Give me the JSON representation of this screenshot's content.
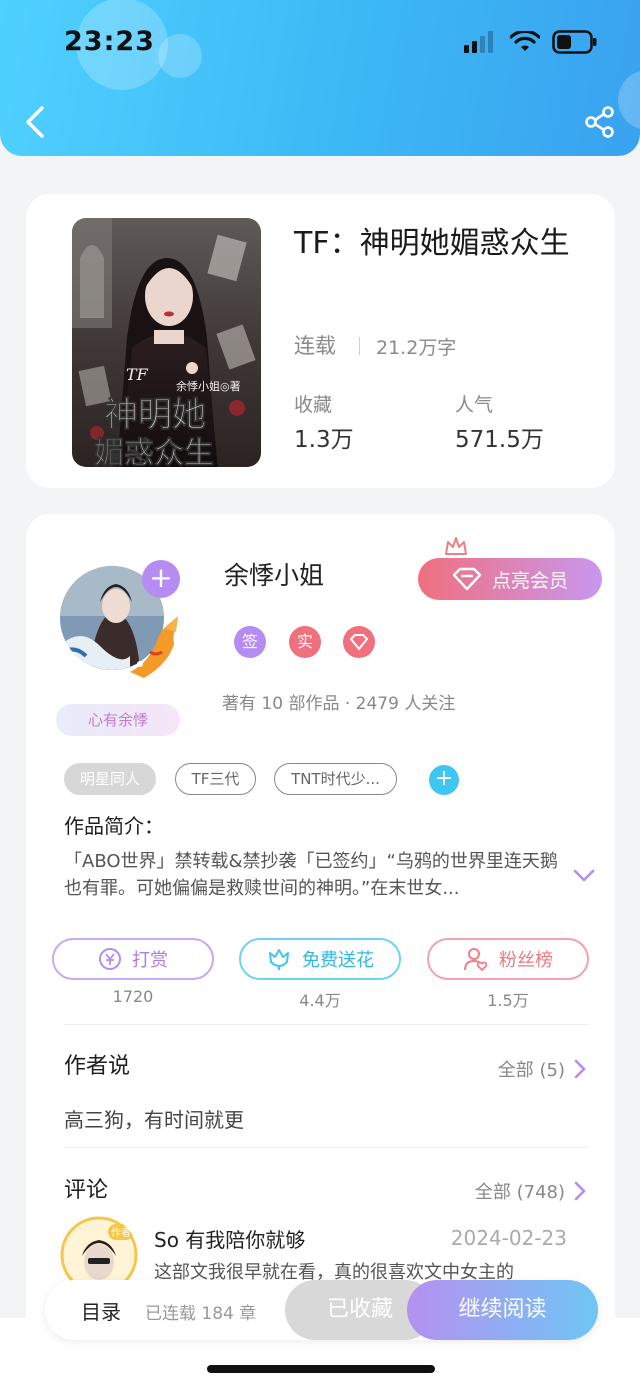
{
  "status_bar": {
    "time": "23:23"
  },
  "header": {
    "back_icon": "chevron-left-icon",
    "share_icon": "share-icon"
  },
  "book": {
    "title": "TF：神明她媚惑众生",
    "status": "连载",
    "word_count": "21.2万字",
    "stats": [
      {
        "label": "收藏",
        "value": "1.3万"
      },
      {
        "label": "人气",
        "value": "571.5万"
      }
    ],
    "cover": {
      "title_line1": "神明她",
      "title_line2": "媚惑众生",
      "prefix": "TF",
      "author_line": "余悸小姐◎著"
    }
  },
  "author": {
    "name": "余悸小姐",
    "vip_button": "点亮会员",
    "badges": [
      "签",
      "实"
    ],
    "meta": "著有 10 部作品 · 2479 人关注",
    "fans_tag": "心有余悸",
    "tags": [
      "明星同人",
      "TF三代",
      "TNT时代少..."
    ],
    "intro_label": "作品简介：",
    "intro": "「ABO世界」禁转载&禁抄袭「已签约」“乌鸦的世界里连天鹅也有罪。可她偏偏是救赎世间的神明。”在末世女..."
  },
  "actions": [
    {
      "label": "打赏",
      "count": "1720",
      "color": "#b48cf2"
    },
    {
      "label": "免费送花",
      "count": "4.4万",
      "color": "#3fc6f2"
    },
    {
      "label": "粉丝榜",
      "count": "1.5万",
      "color": "#ef7f85"
    }
  ],
  "author_says": {
    "title": "作者说",
    "see_all": "全部 (5)",
    "text": "高三狗，有时间就更"
  },
  "comments": {
    "title": "评论",
    "see_all": "全部 (748)",
    "avatar_badge": "作者",
    "items": [
      {
        "user": "So 有我陪你就够",
        "date": "2024-02-23",
        "text": "这部文我很早就在看，真的很喜欢文中女主的"
      }
    ]
  },
  "bottom_bar": {
    "toc": "目录",
    "chapters": "已连载 184 章",
    "collected": "已收藏",
    "continue": "继续阅读"
  }
}
